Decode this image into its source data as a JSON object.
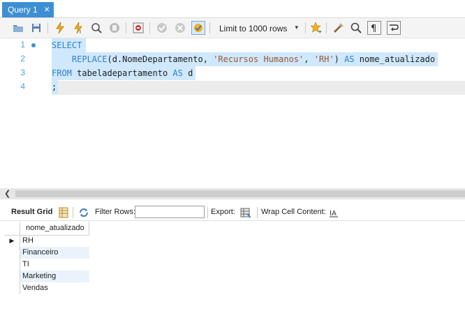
{
  "tabs": [
    {
      "label": "Query 1",
      "close": "×"
    }
  ],
  "toolbar": {
    "limit_label": "Limit to 1000 rows",
    "limit_caret": "▾"
  },
  "editor": {
    "lines": [
      {
        "num": "1"
      },
      {
        "num": "2"
      },
      {
        "num": "3"
      },
      {
        "num": "4"
      }
    ],
    "tokens": {
      "l1_kw": "SELECT",
      "l2_indent": "    ",
      "l2_fn": "REPLACE",
      "l2_a": "(d.NomeDepartamento, ",
      "l2_s1": "'Recursos Humanos'",
      "l2_b": ", ",
      "l2_s2": "'RH'",
      "l2_c": ") ",
      "l2_as": "AS",
      "l2_d": " nome_atualizado",
      "l3_kw": "FROM",
      "l3_a": " tabeladepartamento ",
      "l3_as": "AS",
      "l3_b": " d",
      "l4": ";"
    }
  },
  "results_toolbar": {
    "result_grid": "Result Grid",
    "filter_rows": "Filter Rows:",
    "filter_value": "",
    "export": "Export:",
    "wrap": "Wrap Cell Content:"
  },
  "grid": {
    "column": "nome_atualizado",
    "rows": [
      "RH",
      "Financeiro",
      "TI",
      "Marketing",
      "Vendas"
    ],
    "current_row_marker": "▶"
  },
  "colors": {
    "tab_active": "#3d8fd3",
    "keyword": "#2f7fcf",
    "string": "#a0522d",
    "selection": "#cfe8fc"
  }
}
